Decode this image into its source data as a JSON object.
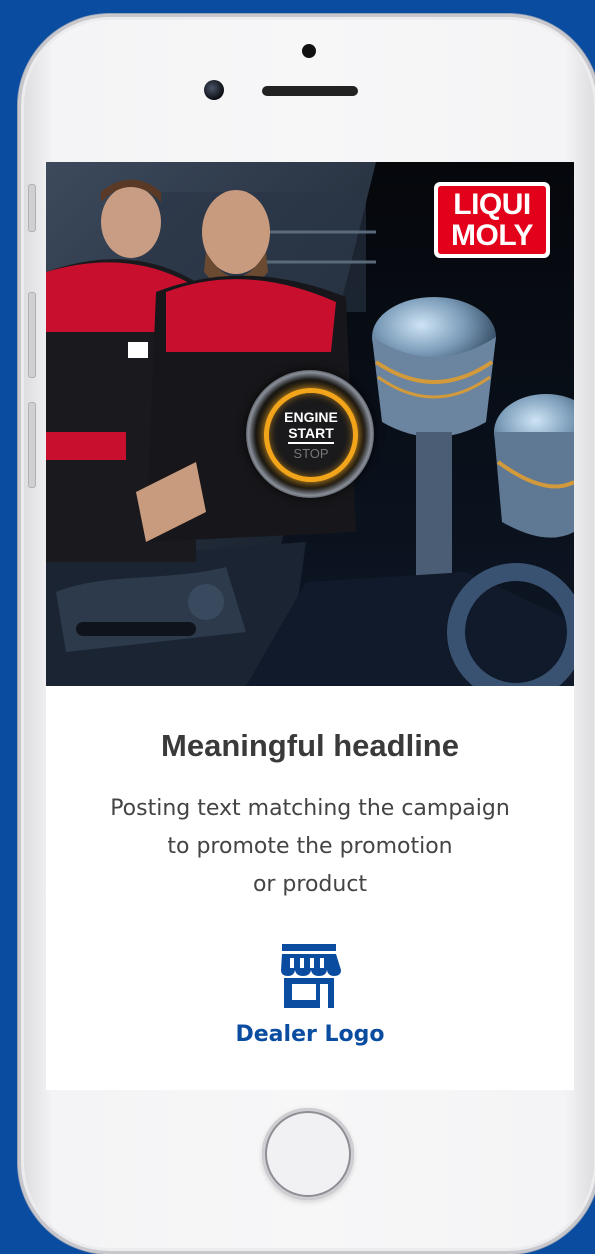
{
  "brand": {
    "logo_line1": "LIQUI",
    "logo_line2": "MOLY",
    "logo_color": "#e2001a"
  },
  "hero": {
    "engine_button": {
      "line1": "ENGINE",
      "line2": "START",
      "line3": "STOP",
      "ring_color": "#f2a51a"
    }
  },
  "post": {
    "headline": "Meaningful headline",
    "body_lines": [
      "Posting text matching the campaign",
      "to promote the promotion",
      "or product"
    ]
  },
  "dealer": {
    "icon": "store-icon",
    "label": "Dealer Logo",
    "color": "#0a4da0"
  },
  "theme": {
    "background": "#0a4da0"
  }
}
